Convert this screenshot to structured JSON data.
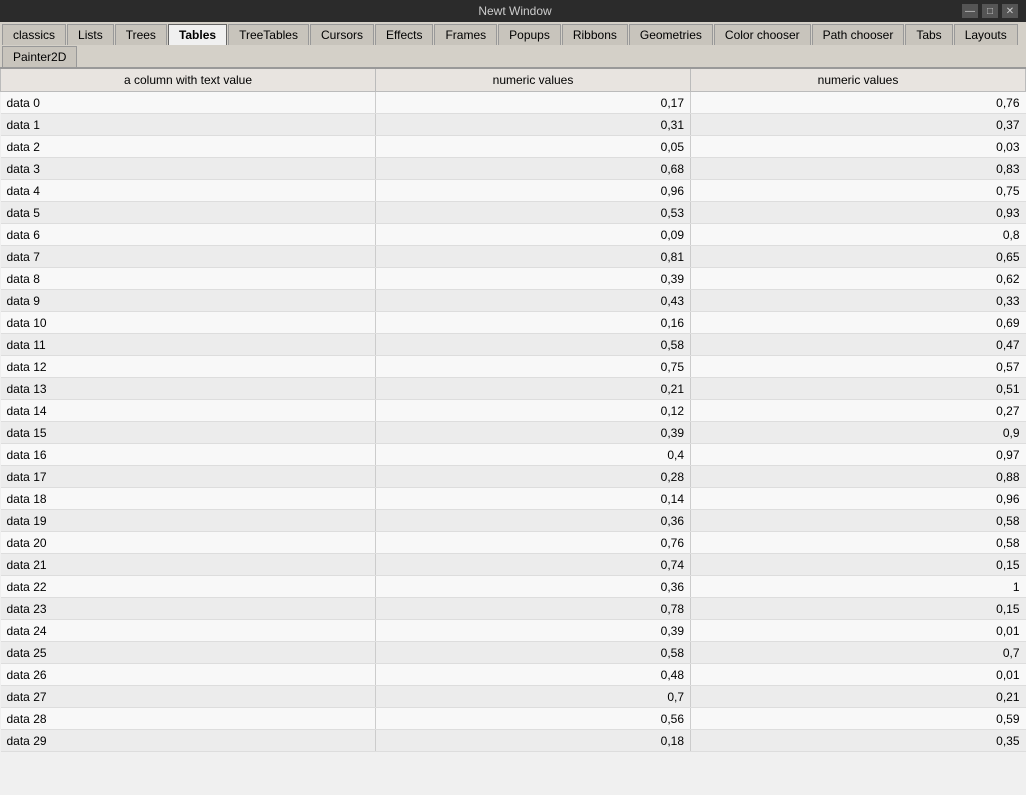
{
  "window": {
    "title": "Newt Window",
    "controls": [
      "—",
      "□",
      "✕"
    ]
  },
  "tabs": [
    {
      "label": "classics",
      "active": false
    },
    {
      "label": "Lists",
      "active": false
    },
    {
      "label": "Trees",
      "active": false
    },
    {
      "label": "Tables",
      "active": true
    },
    {
      "label": "TreeTables",
      "active": false
    },
    {
      "label": "Cursors",
      "active": false
    },
    {
      "label": "Effects",
      "active": false
    },
    {
      "label": "Frames",
      "active": false
    },
    {
      "label": "Popups",
      "active": false
    },
    {
      "label": "Ribbons",
      "active": false
    },
    {
      "label": "Geometries",
      "active": false
    },
    {
      "label": "Color chooser",
      "active": false
    },
    {
      "label": "Path chooser",
      "active": false
    },
    {
      "label": "Tabs",
      "active": false
    },
    {
      "label": "Layouts",
      "active": false
    },
    {
      "label": "Painter2D",
      "active": false
    }
  ],
  "table": {
    "headers": [
      "a column with text value",
      "numeric values",
      "numeric values"
    ],
    "rows": [
      [
        "data 0",
        "0,17",
        "0,76"
      ],
      [
        "data 1",
        "0,31",
        "0,37"
      ],
      [
        "data 2",
        "0,05",
        "0,03"
      ],
      [
        "data 3",
        "0,68",
        "0,83"
      ],
      [
        "data 4",
        "0,96",
        "0,75"
      ],
      [
        "data 5",
        "0,53",
        "0,93"
      ],
      [
        "data 6",
        "0,09",
        "0,8"
      ],
      [
        "data 7",
        "0,81",
        "0,65"
      ],
      [
        "data 8",
        "0,39",
        "0,62"
      ],
      [
        "data 9",
        "0,43",
        "0,33"
      ],
      [
        "data 10",
        "0,16",
        "0,69"
      ],
      [
        "data 11",
        "0,58",
        "0,47"
      ],
      [
        "data 12",
        "0,75",
        "0,57"
      ],
      [
        "data 13",
        "0,21",
        "0,51"
      ],
      [
        "data 14",
        "0,12",
        "0,27"
      ],
      [
        "data 15",
        "0,39",
        "0,9"
      ],
      [
        "data 16",
        "0,4",
        "0,97"
      ],
      [
        "data 17",
        "0,28",
        "0,88"
      ],
      [
        "data 18",
        "0,14",
        "0,96"
      ],
      [
        "data 19",
        "0,36",
        "0,58"
      ],
      [
        "data 20",
        "0,76",
        "0,58"
      ],
      [
        "data 21",
        "0,74",
        "0,15"
      ],
      [
        "data 22",
        "0,36",
        "1"
      ],
      [
        "data 23",
        "0,78",
        "0,15"
      ],
      [
        "data 24",
        "0,39",
        "0,01"
      ],
      [
        "data 25",
        "0,58",
        "0,7"
      ],
      [
        "data 26",
        "0,48",
        "0,01"
      ],
      [
        "data 27",
        "0,7",
        "0,21"
      ],
      [
        "data 28",
        "0,56",
        "0,59"
      ],
      [
        "data 29",
        "0,18",
        "0,35"
      ]
    ]
  }
}
